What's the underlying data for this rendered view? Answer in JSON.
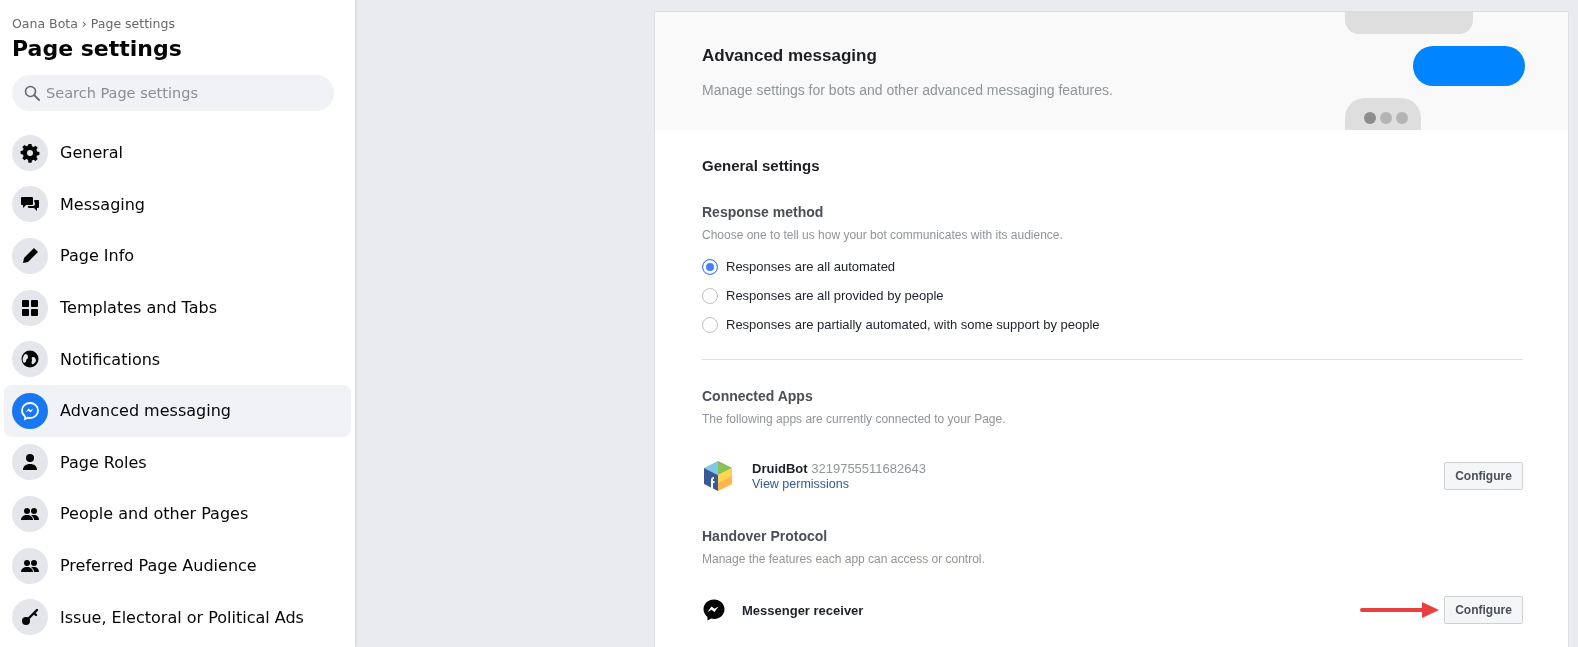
{
  "sidebar": {
    "breadcrumb": [
      "Oana Bota",
      "Page settings"
    ],
    "breadcrumb_separator": "›",
    "title": "Page settings",
    "search": {
      "placeholder": "Search Page settings"
    },
    "items": [
      {
        "label": "General",
        "selected": false
      },
      {
        "label": "Messaging",
        "selected": false
      },
      {
        "label": "Page Info",
        "selected": false
      },
      {
        "label": "Templates and Tabs",
        "selected": false
      },
      {
        "label": "Notifications",
        "selected": false
      },
      {
        "label": "Advanced messaging",
        "selected": true
      },
      {
        "label": "Page Roles",
        "selected": false
      },
      {
        "label": "People and other Pages",
        "selected": false
      },
      {
        "label": "Preferred Page Audience",
        "selected": false
      },
      {
        "label": "Issue, Electoral or Political Ads",
        "selected": false
      }
    ]
  },
  "header": {
    "title": "Advanced messaging",
    "subtitle": "Manage settings for bots and other advanced messaging features."
  },
  "general_settings": {
    "title": "General settings",
    "response_method": {
      "title": "Response method",
      "description": "Choose one to tell us how your bot communicates with its audience.",
      "options": [
        {
          "label": "Responses are all automated",
          "selected": true
        },
        {
          "label": "Responses are all provided by people",
          "selected": false
        },
        {
          "label": "Responses are partially automated, with some support by people",
          "selected": false
        }
      ]
    }
  },
  "connected_apps": {
    "title": "Connected Apps",
    "description": "The following apps are currently connected to your Page.",
    "apps": [
      {
        "name": "DruidBot",
        "id": "3219755511682643",
        "link": "View permissions",
        "button": "Configure"
      }
    ]
  },
  "handover_protocol": {
    "title": "Handover Protocol",
    "description": "Manage the features each app can access or control.",
    "apps": [
      {
        "name": "Messenger receiver",
        "button": "Configure"
      }
    ]
  }
}
